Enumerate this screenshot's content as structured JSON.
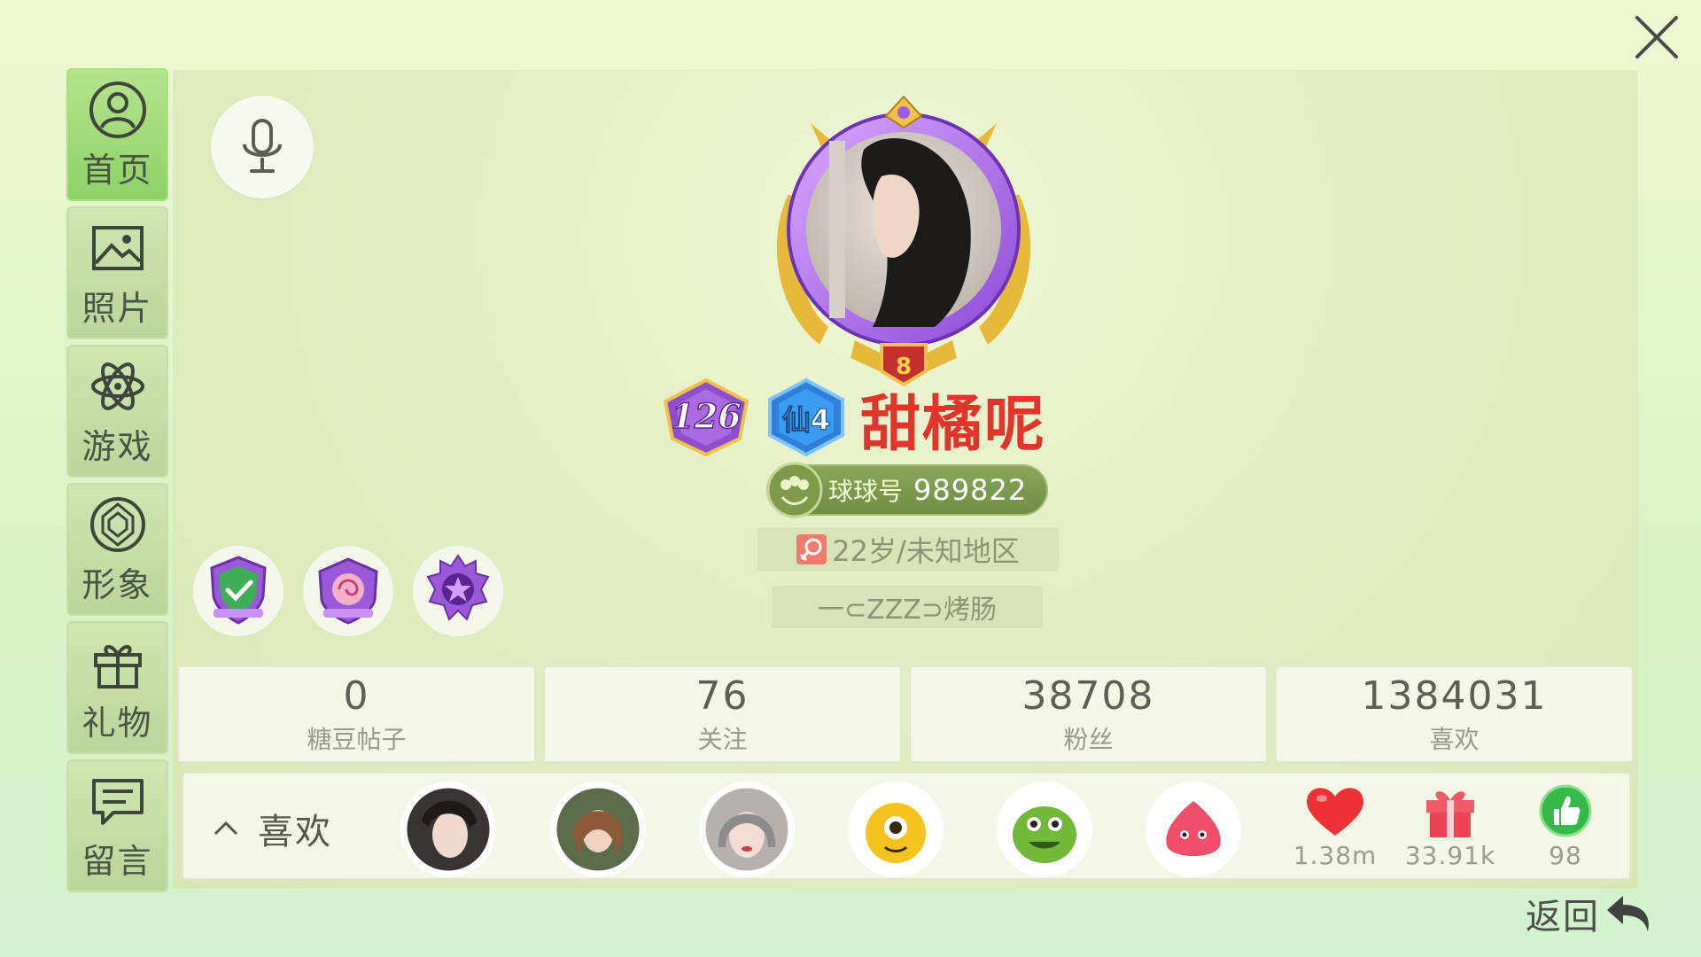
{
  "nav": [
    {
      "label": "首页",
      "icon": "profile-icon",
      "active": true
    },
    {
      "label": "照片",
      "icon": "photo-icon"
    },
    {
      "label": "游戏",
      "icon": "atom-icon"
    },
    {
      "label": "形象",
      "icon": "diamond-icon"
    },
    {
      "label": "礼物",
      "icon": "gift-icon"
    },
    {
      "label": "留言",
      "icon": "message-icon"
    }
  ],
  "profile": {
    "level": "126",
    "vip": "仙4",
    "frame_level": "8",
    "name": "甜橘呢",
    "id_label": "球球号",
    "id_value": "989822",
    "info": "22岁/未知地区",
    "signature": "一⊂ZZZ⊃烤肠"
  },
  "stats": [
    {
      "value": "0",
      "label": "糖豆帖子"
    },
    {
      "value": "76",
      "label": "关注"
    },
    {
      "value": "38708",
      "label": "粉丝"
    },
    {
      "value": "1384031",
      "label": "喜欢"
    }
  ],
  "likes": {
    "title": "喜欢",
    "counters": [
      {
        "icon": "heart-icon",
        "value": "1.38m"
      },
      {
        "icon": "gift-box-icon",
        "value": "33.91k"
      },
      {
        "icon": "thumbs-up-icon",
        "value": "98"
      }
    ]
  },
  "back_label": "返回",
  "colors": {
    "name": "#e2342c",
    "accent_green": "#8fd167",
    "panel_bg": "#e3efc4"
  }
}
